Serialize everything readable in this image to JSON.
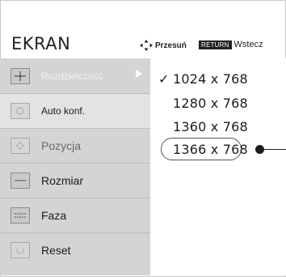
{
  "header": {
    "title": "EKRAN",
    "move_label": "Przesuń",
    "return_key": "RETURN",
    "back_label": "Wstecz"
  },
  "menu": {
    "items": [
      {
        "label": "Rozdzielczość",
        "icon": "resolution-icon",
        "selected": true
      },
      {
        "label": "Auto konf.",
        "icon": "auto-config-icon"
      },
      {
        "label": "Pozycja",
        "icon": "position-icon"
      },
      {
        "label": "Rozmiar",
        "icon": "size-icon"
      },
      {
        "label": "Faza",
        "icon": "phase-icon"
      },
      {
        "label": "Reset",
        "icon": "reset-icon"
      }
    ]
  },
  "resolution": {
    "check_mark": "✓",
    "options": [
      "1024 x 768",
      "1280 x 768",
      "1360 x 768",
      "1366 x 768"
    ],
    "current": "1024 x 768",
    "highlighted": "1366 x 768"
  }
}
